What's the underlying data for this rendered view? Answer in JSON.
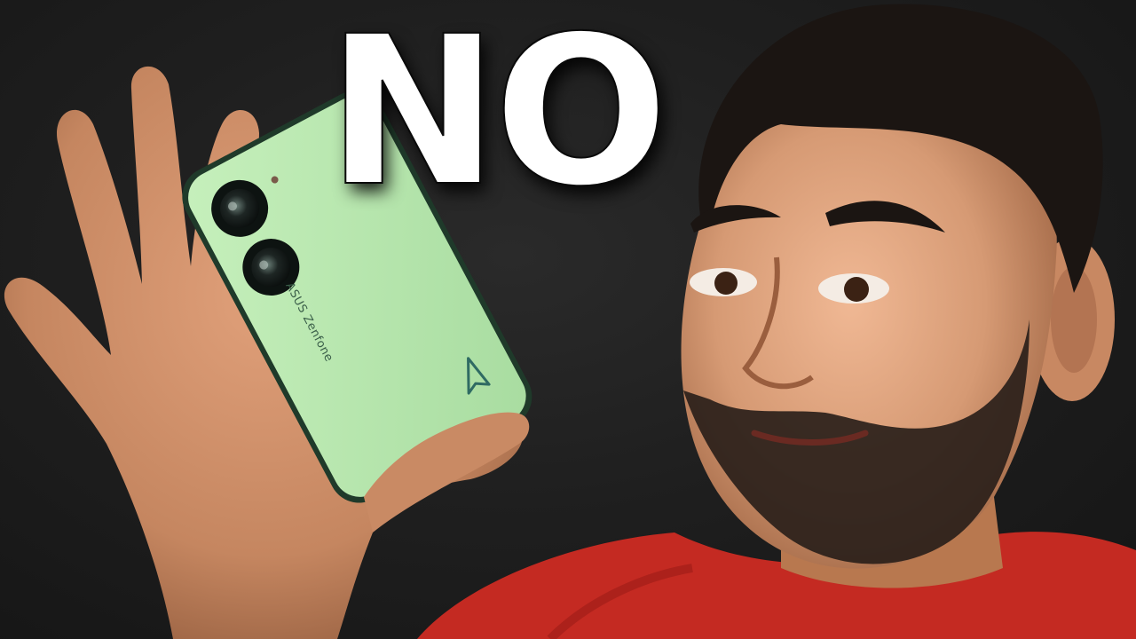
{
  "headline": {
    "text": "NO"
  },
  "phone": {
    "brand_text": "ASUS Zenfone",
    "color": "#b8e8b0",
    "logo": "asus-triangle-logo"
  },
  "colors": {
    "background": "#1c1c1c",
    "headline": "#ffffff",
    "skin": "#c98a64",
    "shirt": "#c42a22",
    "hair": "#1b1512"
  }
}
